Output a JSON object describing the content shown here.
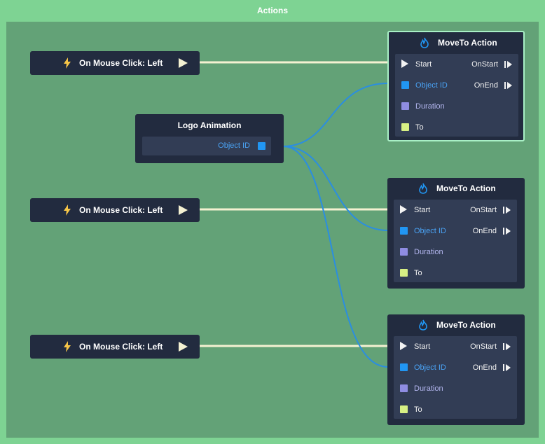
{
  "window": {
    "title": "Actions"
  },
  "triggers": [
    {
      "label": "On Mouse Click: Left",
      "icon": "lightning-icon",
      "out_icon": "play-icon"
    },
    {
      "label": "On Mouse Click: Left",
      "icon": "lightning-icon",
      "out_icon": "play-icon"
    },
    {
      "label": "On Mouse Click: Left",
      "icon": "lightning-icon",
      "out_icon": "play-icon"
    }
  ],
  "logo_node": {
    "title": "Logo Animation",
    "output_label": "Object ID"
  },
  "actions": [
    {
      "title": "MoveTo Action",
      "icon": "fire-icon",
      "start": "Start",
      "on_start": "OnStart",
      "object_id": "Object ID",
      "on_end": "OnEnd",
      "duration": "Duration",
      "to": "To"
    },
    {
      "title": "MoveTo Action",
      "icon": "fire-icon",
      "start": "Start",
      "on_start": "OnStart",
      "object_id": "Object ID",
      "on_end": "OnEnd",
      "duration": "Duration",
      "to": "To"
    },
    {
      "title": "MoveTo Action",
      "icon": "fire-icon",
      "start": "Start",
      "on_start": "OnStart",
      "object_id": "Object ID",
      "on_end": "OnEnd",
      "duration": "Duration",
      "to": "To"
    }
  ],
  "colors": {
    "frame": "#7ed393",
    "canvas": "#63a277",
    "node": "#222b3f",
    "node_body": "#323d55",
    "flow_wire": "#f4f1d2",
    "data_wire": "#2b8ee0",
    "object_pin": "#2196f3",
    "duration_pin": "#8f8de2",
    "to_pin": "#d7f084",
    "selected_border": "#a9f0c6"
  }
}
